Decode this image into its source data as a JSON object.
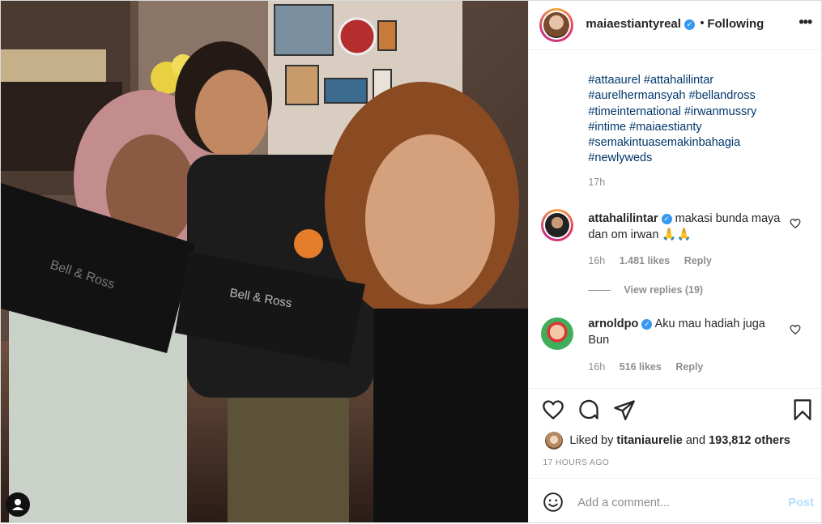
{
  "post": {
    "username": "maiaestiantyreal",
    "separator": "•",
    "follow_status": "Following",
    "more_icon": "more-horizontal-icon",
    "hashtags": [
      "#attaaurel #attahalilintar",
      "#aurelhermansyah #bellandross",
      "#timeinternational #irwanmussry",
      "#intime #maiaestianty",
      "#semakintuasemakinbahagia",
      "#newlyweds"
    ],
    "caption_time": "17h"
  },
  "comments": [
    {
      "username": "attahalilintar",
      "text": "makasi bunda maya dan om irwan 🙏🙏",
      "time": "16h",
      "likes": "1.481 likes",
      "reply": "Reply",
      "view_replies": "View replies (19)"
    },
    {
      "username": "arnoldpo",
      "text": "Aku mau hadiah juga Bun",
      "time": "16h",
      "likes": "516 likes",
      "reply": "Reply"
    }
  ],
  "actions": {
    "icons": [
      "heart-icon",
      "comment-icon",
      "share-icon",
      "bookmark-icon"
    ]
  },
  "liked_by": {
    "prefix": "Liked by",
    "user": "titaniaurelie",
    "middle": "and",
    "others": "193,812 others"
  },
  "time_ago": "17 HOURS AGO",
  "add_comment": {
    "placeholder": "Add a comment...",
    "post_label": "Post"
  },
  "colors": {
    "link": "#00376b",
    "verified": "#3897f0",
    "post_disabled": "#b2dffc",
    "muted": "#8e8e8e"
  }
}
